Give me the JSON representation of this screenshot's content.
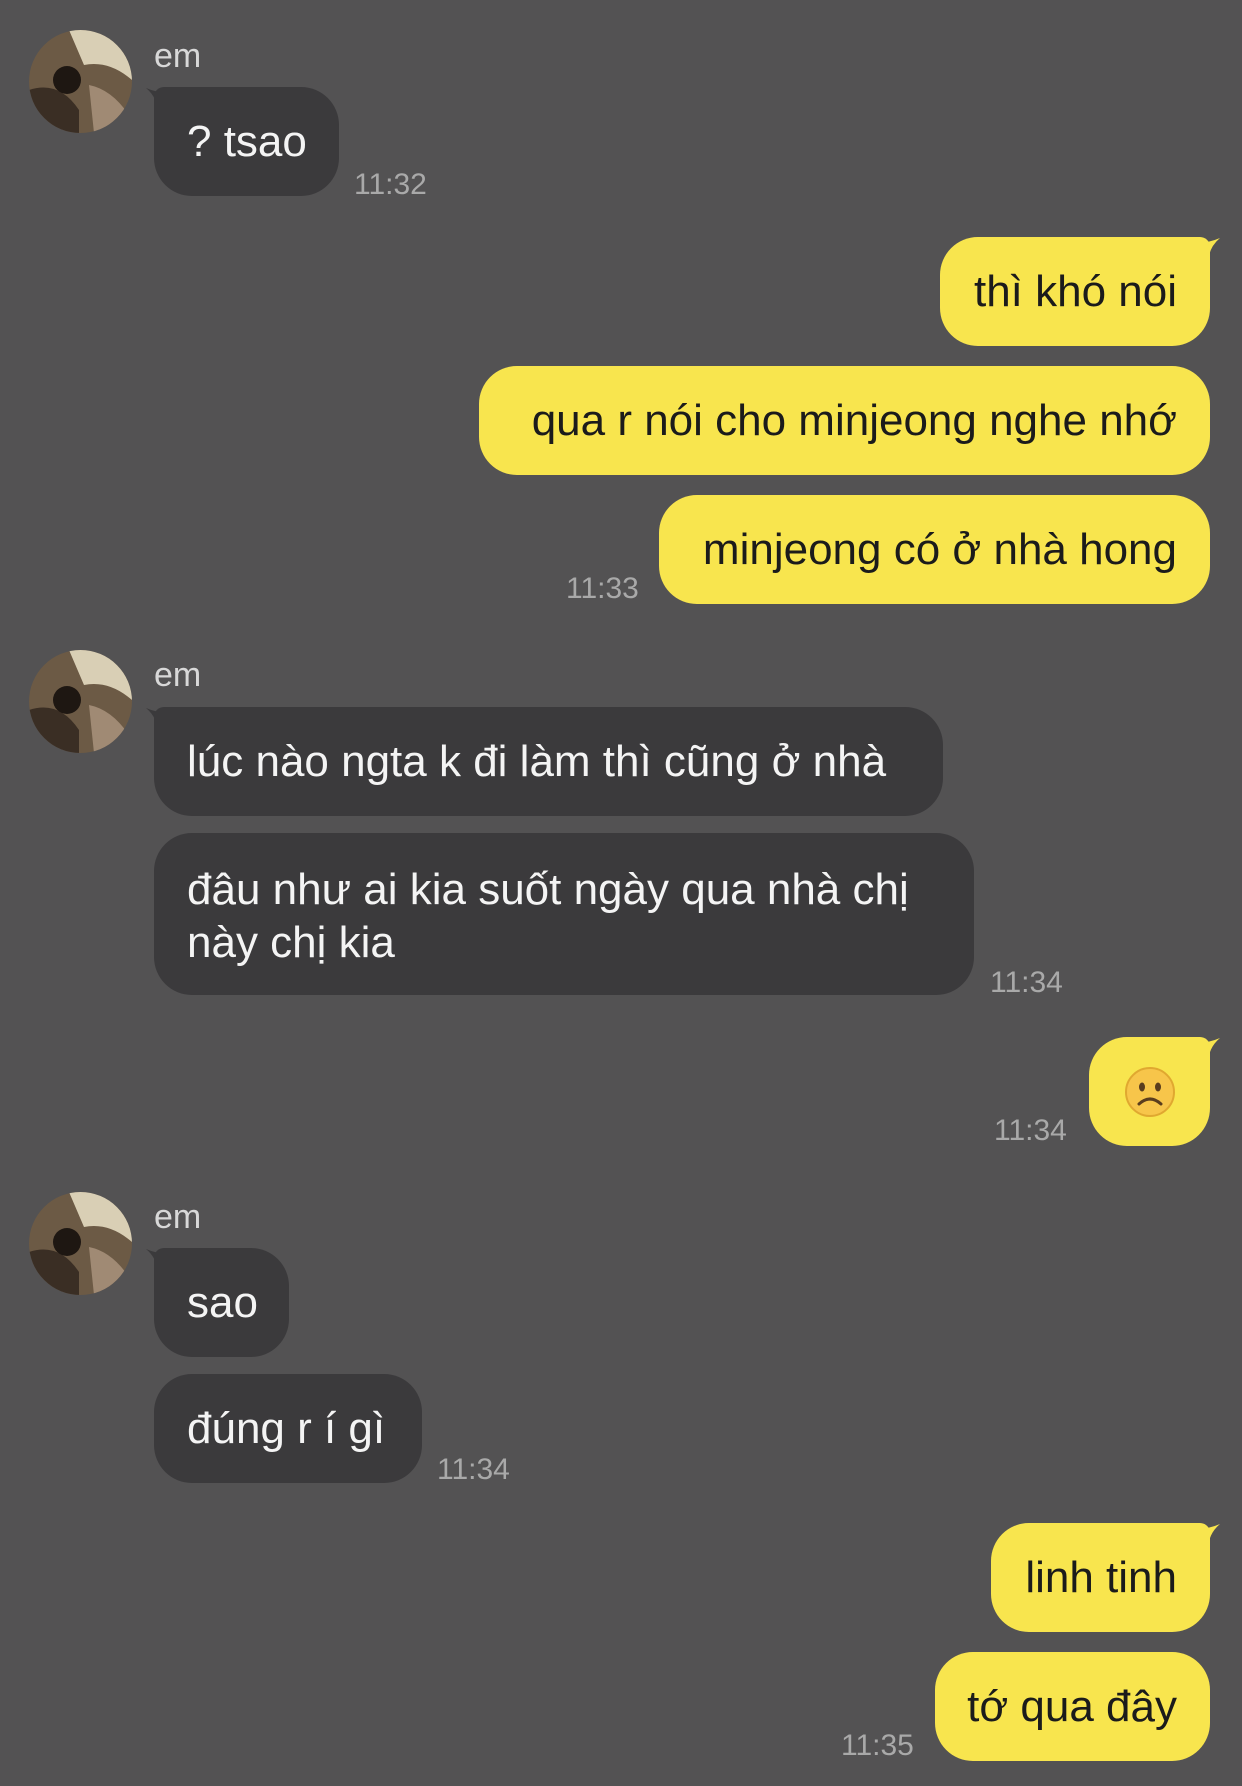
{
  "colors": {
    "background": "#535253",
    "incoming_bubble": "#3b3a3c",
    "outgoing_bubble": "#f8e54e",
    "time_text": "#a9a9a9"
  },
  "groups": [
    {
      "sender": "em",
      "messages": [
        "? tsao"
      ],
      "time": "11:32"
    },
    {
      "messages": [
        "thì khó nói",
        "qua r nói cho minjeong nghe nhớ",
        "minjeong có ở nhà hong"
      ],
      "time": "11:33"
    },
    {
      "sender": "em",
      "messages": [
        "lúc nào ngta k đi làm thì cũng ở nhà",
        "đâu như ai kia suốt ngày qua nhà chị này chị kia"
      ],
      "time": "11:34"
    },
    {
      "messages": [
        "☹️"
      ],
      "time": "11:34"
    },
    {
      "sender": "em",
      "messages": [
        "sao",
        "đúng r í gì"
      ],
      "time": "11:34"
    },
    {
      "messages": [
        "linh tinh",
        "tớ qua đây"
      ],
      "time": "11:35"
    }
  ]
}
